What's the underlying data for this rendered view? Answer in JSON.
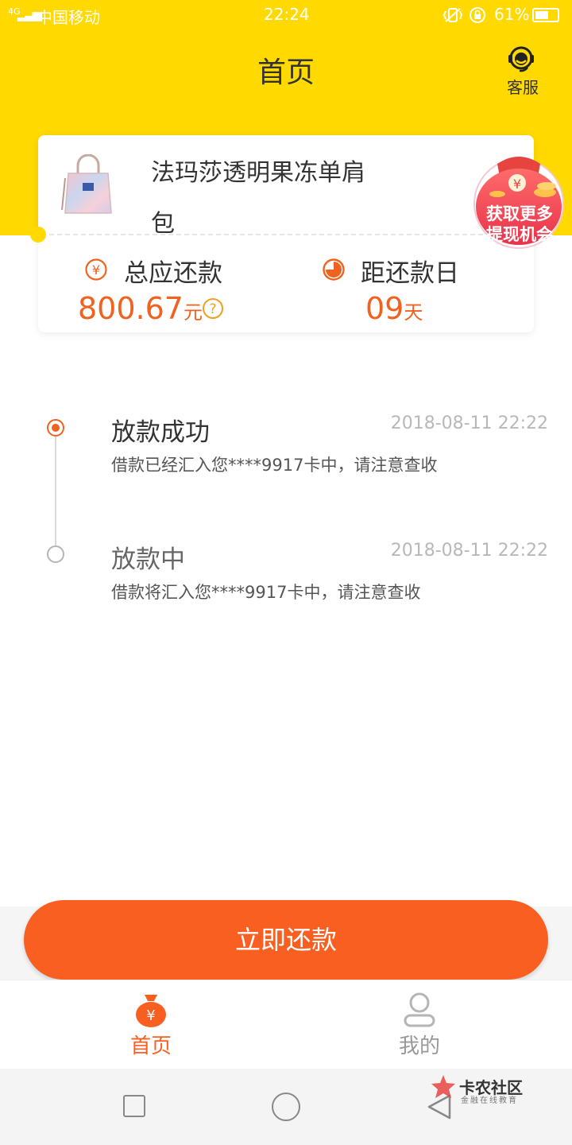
{
  "status_bar": {
    "network": "4G",
    "carrier": "中国移动",
    "time": "22:24",
    "battery": "61%",
    "battery_level": 0.61
  },
  "header": {
    "title": "首页",
    "service_label": "客服"
  },
  "product": {
    "name_line1": "法玛莎透明果冻单肩",
    "name_line2": "包"
  },
  "promo": {
    "line1": "获取更多",
    "line2": "提现机会"
  },
  "summary": {
    "total_label": "总应还款",
    "total_value": "800.67",
    "total_unit": "元",
    "due_label": "距还款日",
    "due_value": "09",
    "due_unit": "天"
  },
  "timeline": [
    {
      "title": "放款成功",
      "time": "2018-08-11 22:22",
      "desc": "借款已经汇入您****9917卡中，请注意查收",
      "active": true
    },
    {
      "title": "放款中",
      "time": "2018-08-11 22:22",
      "desc": "借款将汇入您****9917卡中，请注意查收",
      "active": false
    }
  ],
  "pay_button": "立即还款",
  "tabs": [
    {
      "label": "首页",
      "icon": "money-bag-icon",
      "active": true
    },
    {
      "label": "我的",
      "icon": "person-icon",
      "active": false
    }
  ],
  "watermark": {
    "title": "卡农社区",
    "subtitle": "金融在线教育"
  },
  "colors": {
    "header_yellow": "#FFD900",
    "accent_orange": "#F0621F",
    "button_orange": "#F95F20"
  }
}
